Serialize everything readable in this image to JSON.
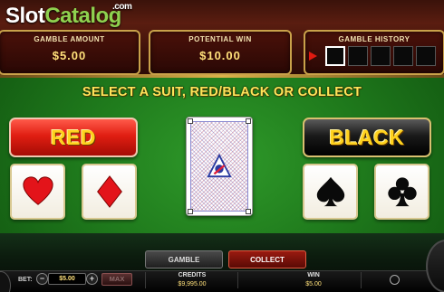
{
  "logo": {
    "part1": "Slot",
    "part2": "Catalog",
    "suffix": ".com"
  },
  "panels": {
    "gamble_amount": {
      "title": "GAMBLE AMOUNT",
      "value": "$5.00"
    },
    "potential_win": {
      "title": "POTENTIAL WIN",
      "value": "$10.00"
    },
    "gamble_history": {
      "title": "GAMBLE HISTORY",
      "slots": 5,
      "active_slot": 0
    }
  },
  "instruction": "SELECT A SUIT, RED/BLACK OR COLLECT",
  "buttons": {
    "red": "RED",
    "black": "BLACK"
  },
  "suits": [
    "heart-icon",
    "diamond-icon",
    "spade-icon",
    "club-icon"
  ],
  "colors": {
    "red": "#e01e12",
    "black": "#111111",
    "gold": "#ffd21e",
    "felt": "#1f7a1c"
  },
  "tabs": {
    "gamble": "GAMBLE",
    "collect": "COLLECT"
  },
  "footer": {
    "bet_label": "BET:",
    "bet_value": "$5.00",
    "minus": "−",
    "plus": "+",
    "max": "MAX",
    "credits_label": "CREDITS",
    "credits_value": "$9,995.00",
    "win_label": "WIN",
    "win_value": "$5.00"
  }
}
